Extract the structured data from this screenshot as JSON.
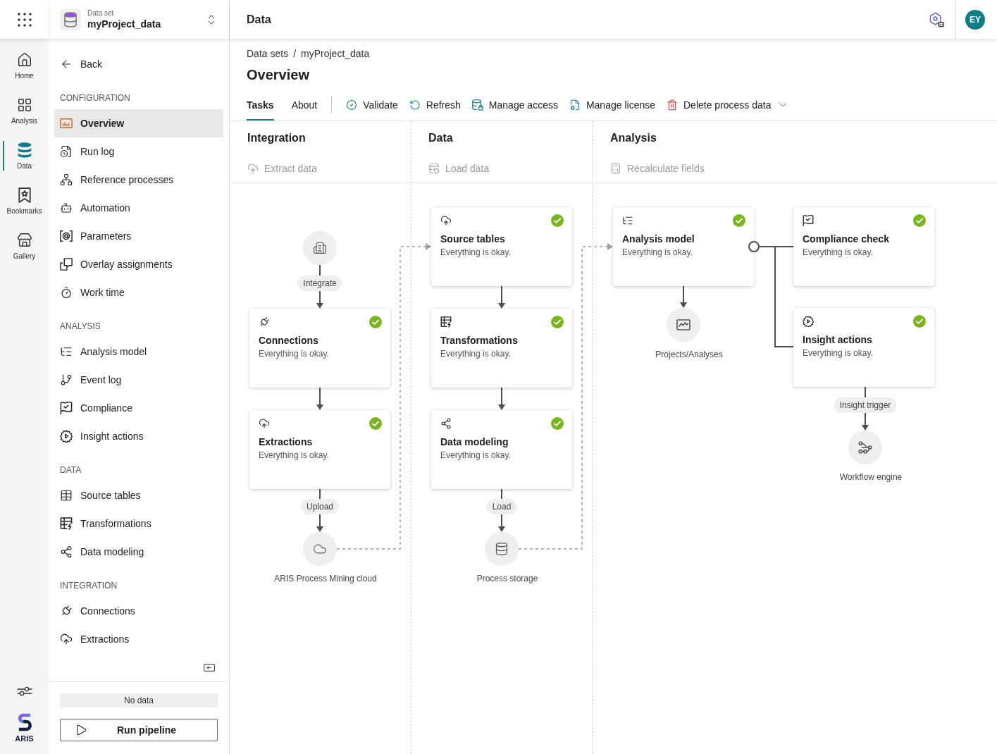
{
  "app_rail": {
    "items": [
      {
        "label": "Home",
        "selected": false
      },
      {
        "label": "Analysis",
        "selected": false
      },
      {
        "label": "Data",
        "selected": true
      },
      {
        "label": "Bookmarks",
        "selected": false
      },
      {
        "label": "Gallery",
        "selected": false
      }
    ],
    "logo": "ARIS"
  },
  "dataset": {
    "caption": "Data set",
    "name": "myProject_data"
  },
  "sidebar": {
    "back": "Back",
    "sections": [
      {
        "heading": "CONFIGURATION",
        "items": [
          {
            "label": "Overview",
            "selected": true
          },
          {
            "label": "Run log",
            "selected": false
          },
          {
            "label": "Reference processes",
            "selected": false
          },
          {
            "label": "Automation",
            "selected": false
          },
          {
            "label": "Parameters",
            "selected": false
          },
          {
            "label": "Overlay assignments",
            "selected": false
          },
          {
            "label": "Work time",
            "selected": false
          }
        ]
      },
      {
        "heading": "ANALYSIS",
        "items": [
          {
            "label": "Analysis model",
            "selected": false
          },
          {
            "label": "Event log",
            "selected": false
          },
          {
            "label": "Compliance",
            "selected": false
          },
          {
            "label": "Insight actions",
            "selected": false
          }
        ]
      },
      {
        "heading": "DATA",
        "items": [
          {
            "label": "Source tables",
            "selected": false
          },
          {
            "label": "Transformations",
            "selected": false
          },
          {
            "label": "Data modeling",
            "selected": false
          }
        ]
      },
      {
        "heading": "INTEGRATION",
        "items": [
          {
            "label": "Connections",
            "selected": false
          },
          {
            "label": "Extractions",
            "selected": false
          }
        ]
      }
    ],
    "status": "No data",
    "run_button": "Run pipeline"
  },
  "header": {
    "title": "Data",
    "avatar": "EY"
  },
  "breadcrumb": {
    "items": [
      "Data sets",
      "myProject_data"
    ],
    "separator": "/"
  },
  "page_title": "Overview",
  "tabs": [
    {
      "label": "Tasks",
      "selected": true
    },
    {
      "label": "About",
      "selected": false
    }
  ],
  "actions": [
    {
      "kind": "validate",
      "label": "Validate",
      "menu": false
    },
    {
      "kind": "refresh",
      "label": "Refresh",
      "menu": false
    },
    {
      "kind": "access",
      "label": "Manage access",
      "menu": false
    },
    {
      "kind": "license",
      "label": "Manage license",
      "menu": false
    },
    {
      "kind": "delete",
      "label": "Delete process data",
      "menu": true
    }
  ],
  "columns": [
    {
      "title": "Integration",
      "action": {
        "kind": "extract",
        "label": "Extract data",
        "disabled": true
      },
      "cards": [
        {
          "title": "Connections",
          "status": "Everything is okay.",
          "ok": true
        },
        {
          "title": "Extractions",
          "status": "Everything is okay.",
          "ok": true
        }
      ],
      "nodes": [
        {
          "kind": "building"
        },
        {
          "kind": "cloud",
          "label": "ARIS Process Mining cloud"
        }
      ],
      "edge_labels": [
        "Integrate",
        "Upload"
      ]
    },
    {
      "title": "Data",
      "action": {
        "kind": "load",
        "label": "Load data",
        "disabled": true
      },
      "cards": [
        {
          "title": "Source tables",
          "status": "Everything is okay.",
          "ok": true
        },
        {
          "title": "Transformations",
          "status": "Everything is okay.",
          "ok": true
        },
        {
          "title": "Data modeling",
          "status": "Everything is okay.",
          "ok": true
        }
      ],
      "nodes": [
        {
          "kind": "storage",
          "label": "Process storage"
        }
      ],
      "edge_labels": [
        "Load"
      ]
    },
    {
      "title": "Analysis",
      "action": {
        "kind": "recalculate",
        "label": "Recalculate fields",
        "disabled": true
      },
      "cards": [
        {
          "title": "Analysis model",
          "status": "Everything is okay.",
          "ok": true
        },
        {
          "title": "Compliance check",
          "status": "Everything is okay.",
          "ok": true
        },
        {
          "title": "Insight actions",
          "status": "Everything is okay.",
          "ok": true
        }
      ],
      "nodes": [
        {
          "kind": "chart",
          "label": "Projects/Analyses"
        },
        {
          "kind": "workflow",
          "label": "Workflow engine"
        }
      ],
      "edge_labels": [
        "Insight trigger"
      ]
    }
  ]
}
